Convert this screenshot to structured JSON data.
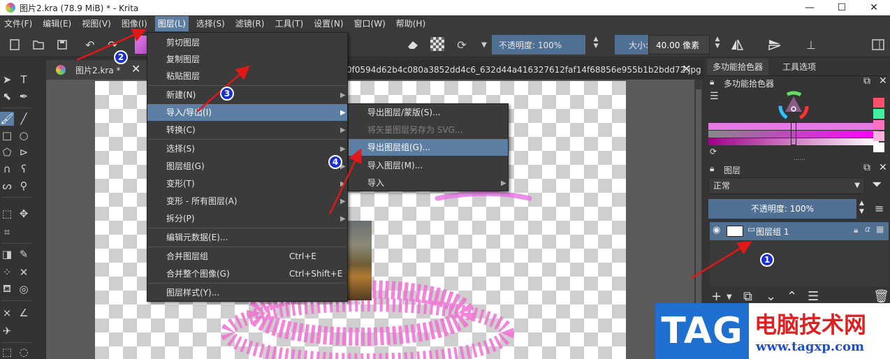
{
  "window": {
    "title": "图片2.kra (78.9 MiB)  * - Krita",
    "minimize": "—",
    "maximize": "☐",
    "close": "✕"
  },
  "menubar": [
    "文件(F)",
    "编辑(E)",
    "视图(V)",
    "图像(I)",
    "图层(L)",
    "选择(S)",
    "滤镜(R)",
    "工具(T)",
    "设置(N)",
    "窗口(W)",
    "帮助(H)"
  ],
  "toolbar": {
    "opacity_label": "不透明度: 100%",
    "size_label": "大小:",
    "size_value": "40.00 像素"
  },
  "tabs": {
    "tab1": "图片2.kra *",
    "tab2": "0f0594d62b4c080a3852dd4c6_632d44a416327612faf14f68856e955b1b2bdd72.jpg"
  },
  "layer_menu": {
    "items": [
      {
        "label": "剪切图层"
      },
      {
        "label": "复制图层"
      },
      {
        "label": "粘贴图层"
      },
      {
        "label": "新建(N)",
        "submenu": true
      },
      {
        "label": "导入/导出(I)",
        "submenu": true,
        "highlighted": true
      },
      {
        "label": "转换(C)",
        "submenu": true
      },
      {
        "label": "选择(S)",
        "submenu": true
      },
      {
        "label": "图层组(G)",
        "submenu": true
      },
      {
        "label": "变形(T)",
        "submenu": true
      },
      {
        "label": "变形 - 所有图层(A)",
        "submenu": true
      },
      {
        "label": "拆分(P)",
        "submenu": true
      },
      {
        "label": "编辑元数据(E)..."
      },
      {
        "label": "合并图层组",
        "shortcut": "Ctrl+E"
      },
      {
        "label": "合并整个图像(G)",
        "shortcut": "Ctrl+Shift+E"
      },
      {
        "label": "图层样式(Y)..."
      }
    ]
  },
  "io_submenu": {
    "items": [
      {
        "label": "导出图层/蒙版(S)..."
      },
      {
        "label": "将矢量图层另存为 SVG...",
        "disabled": true
      },
      {
        "label": "导出图层组(G)...",
        "highlighted": true
      },
      {
        "label": "导入图层(M)..."
      },
      {
        "label": "导入",
        "submenu": true
      }
    ]
  },
  "dockers": {
    "tab_color": "多功能拾色器",
    "tab_tool": "工具选项",
    "color_panel_title": "多功能拾色器",
    "layers_title": "图层",
    "blend_mode": "正常",
    "layer_opacity": "不透明度: 100%",
    "layer_name": "图层组 1",
    "dots": "......"
  },
  "annotations": [
    "1",
    "2",
    "3",
    "4"
  ],
  "watermark": {
    "tag": "TAG",
    "site_name": "电脑技术网",
    "url": "www.tagxp.com"
  },
  "colors": {
    "accent": "#5d7ea3",
    "badge": "#1a2fd0",
    "arrow": "#e01818",
    "brush_pink": "#e779e6"
  }
}
